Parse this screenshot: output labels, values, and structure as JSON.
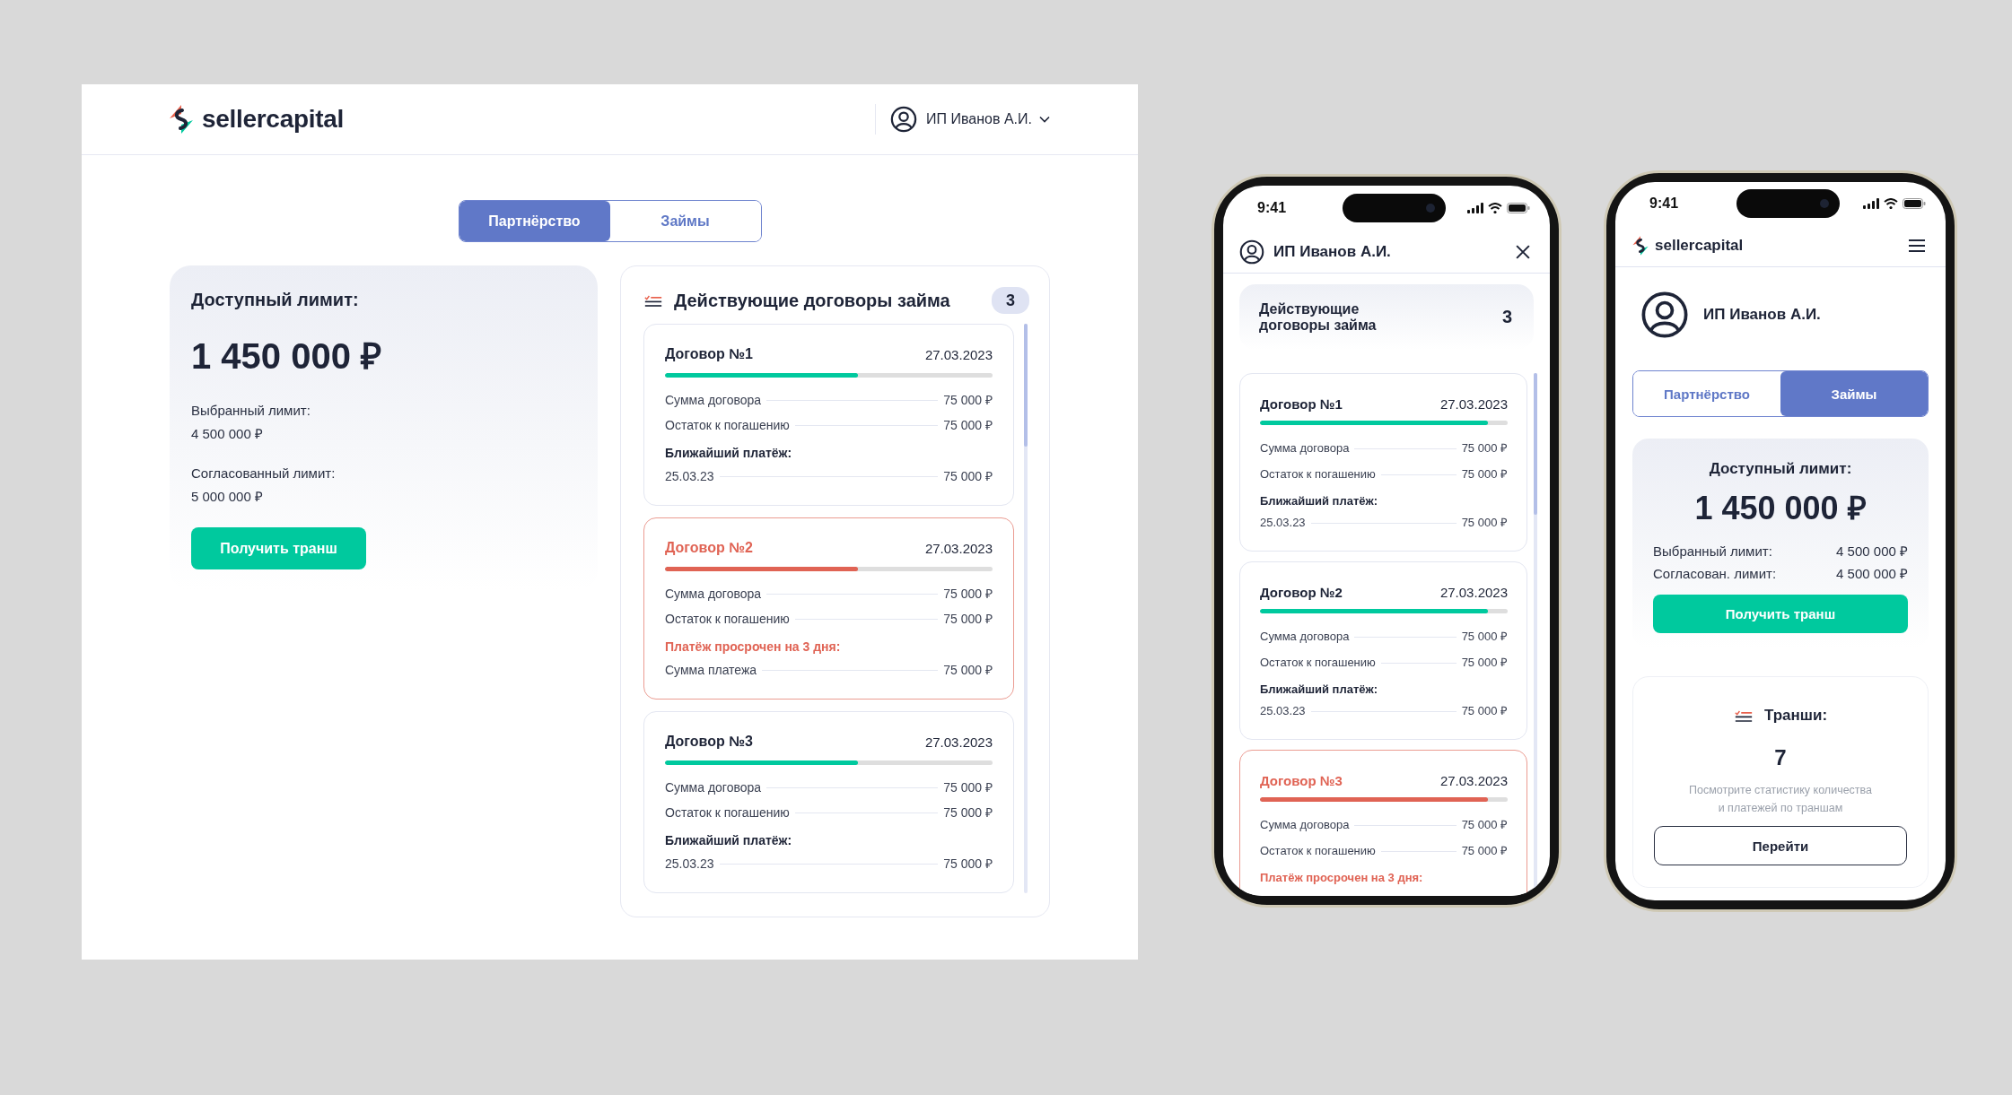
{
  "desktop": {
    "header": {
      "logo": "sellercapital",
      "user": "ИП Иванов А.И."
    },
    "tabs": [
      {
        "label": "Партнёрство",
        "selected": true
      },
      {
        "label": "Займы",
        "selected": false
      }
    ],
    "limit_card": {
      "title": "Доступный лимит:",
      "amount": "1 450 000 ₽",
      "rows": [
        {
          "label": "Выбранный лимит:",
          "value": "4 500 000 ₽"
        },
        {
          "label": "Согласованный лимит:",
          "value": "5 000 000 ₽"
        }
      ],
      "button": "Получить транш"
    },
    "contracts_panel": {
      "title": "Действующие договоры займа",
      "count": "3",
      "contracts": [
        {
          "title": "Договор №1",
          "date": "27.03.2023",
          "overdue": false,
          "level": 0.59,
          "lines": [
            {
              "kind": "row",
              "label": "Сумма договора",
              "value": "75 000 ₽"
            },
            {
              "kind": "row",
              "label": "Остаток к погашению",
              "value": "75 000 ₽"
            },
            {
              "kind": "heading",
              "text": "Ближайший платёж:"
            },
            {
              "kind": "row",
              "label": "25.03.23",
              "value": "75 000 ₽"
            }
          ]
        },
        {
          "title": "Договор №2",
          "date": "27.03.2023",
          "overdue": true,
          "level": 0.59,
          "lines": [
            {
              "kind": "row",
              "label": "Сумма договора",
              "value": "75 000 ₽"
            },
            {
              "kind": "row",
              "label": "Остаток к погашению",
              "value": "75 000 ₽"
            },
            {
              "kind": "heading",
              "text": "Платёж просрочен на 3 дня:"
            },
            {
              "kind": "row",
              "label": "Сумма платежа",
              "value": "75 000 ₽"
            }
          ]
        },
        {
          "title": "Договор №3",
          "date": "27.03.2023",
          "overdue": false,
          "level": 0.59,
          "lines": [
            {
              "kind": "row",
              "label": "Сумма договора",
              "value": "75 000 ₽"
            },
            {
              "kind": "row",
              "label": "Остаток к погашению",
              "value": "75 000 ₽"
            },
            {
              "kind": "heading",
              "text": "Ближайший платёж:"
            },
            {
              "kind": "row",
              "label": "25.03.23",
              "value": "75 000 ₽"
            }
          ]
        }
      ]
    }
  },
  "phone_1": {
    "status_bar": {
      "time": "9:41"
    },
    "header": {
      "user": "ИП Иванов А.И."
    },
    "summary": {
      "title": "Действующие договоры займа",
      "count": "3"
    },
    "contracts": [
      {
        "title": "Договор №1",
        "date": "27.03.2023",
        "overdue": false,
        "level": 0.92,
        "lines": [
          {
            "kind": "row",
            "label": "Сумма договора",
            "value": "75 000 ₽"
          },
          {
            "kind": "row",
            "label": "Остаток к погашению",
            "value": "75 000 ₽"
          },
          {
            "kind": "heading",
            "text": "Ближайший платёж:"
          },
          {
            "kind": "row",
            "label": "25.03.23",
            "value": "75 000 ₽"
          }
        ]
      },
      {
        "title": "Договор №2",
        "date": "27.03.2023",
        "overdue": false,
        "level": 0.92,
        "lines": [
          {
            "kind": "row",
            "label": "Сумма договора",
            "value": "75 000 ₽"
          },
          {
            "kind": "row",
            "label": "Остаток к погашению",
            "value": "75 000 ₽"
          },
          {
            "kind": "heading",
            "text": "Ближайший платёж:"
          },
          {
            "kind": "row",
            "label": "25.03.23",
            "value": "75 000 ₽"
          }
        ]
      },
      {
        "title": "Договор №3",
        "date": "27.03.2023",
        "overdue": true,
        "level": 0.92,
        "lines": [
          {
            "kind": "row",
            "label": "Сумма договора",
            "value": "75 000 ₽"
          },
          {
            "kind": "row",
            "label": "Остаток к погашению",
            "value": "75 000 ₽"
          },
          {
            "kind": "heading",
            "text": "Платёж просрочен на 3 дня:"
          }
        ]
      }
    ]
  },
  "phone_2": {
    "status_bar": {
      "time": "9:41"
    },
    "header": {
      "logo": "sellercapital"
    },
    "user": "ИП Иванов А.И.",
    "tabs": [
      {
        "label": "Партнёрство",
        "selected": false
      },
      {
        "label": "Займы",
        "selected": true
      }
    ],
    "limit_card": {
      "title": "Доступный лимит:",
      "amount": "1 450 000 ₽",
      "rows": [
        {
          "label": "Выбранный лимит:",
          "value": "4 500 000 ₽"
        },
        {
          "label": "Согласован. лимит:",
          "value": "4 500 000 ₽"
        }
      ],
      "button": "Получить транш"
    },
    "tranches_card": {
      "title": "Транши:",
      "count": "7",
      "description": "Посмотрите статистику количества и платежей по траншам",
      "button": "Перейти"
    }
  }
}
